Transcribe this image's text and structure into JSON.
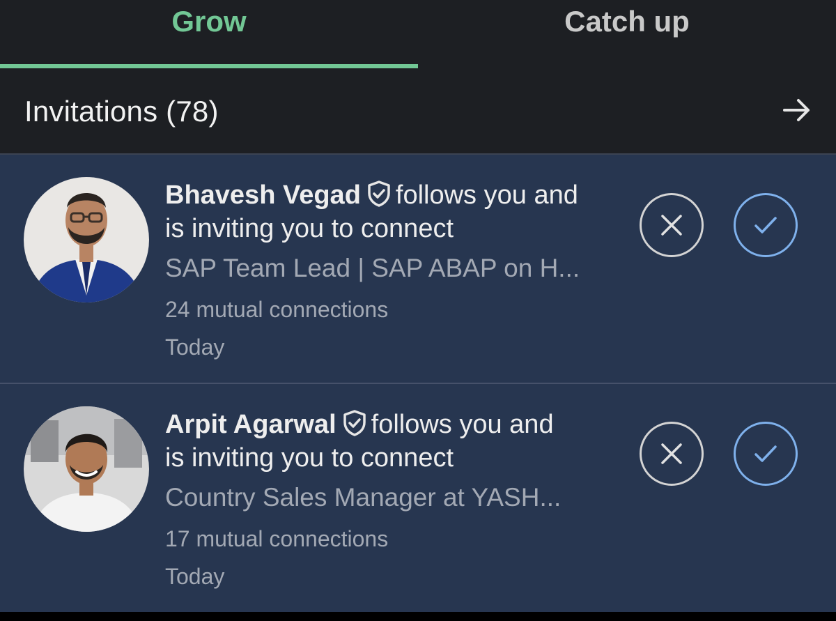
{
  "tabs": [
    {
      "label": "Grow",
      "active": true
    },
    {
      "label": "Catch up",
      "active": false
    }
  ],
  "colors": {
    "accent": "#72c795",
    "card_bg": "#273650",
    "header_bg": "#1d1f23",
    "accept_blue": "#7fb1ec"
  },
  "invitations": {
    "title": "Invitations (78)",
    "arrow_icon": "arrow-right-icon",
    "items": [
      {
        "name": "Bhavesh Vegad",
        "verified_icon": "verified-shield-icon",
        "action_text": "follows you and",
        "action_text_2": "is inviting you to connect",
        "headline": "SAP Team Lead | SAP ABAP on H...",
        "mutual": "24 mutual connections",
        "time": "Today"
      },
      {
        "name": "Arpit Agarwal",
        "verified_icon": "verified-shield-icon",
        "action_text": "follows you and",
        "action_text_2": "is inviting you to connect",
        "headline": "Country Sales Manager at YASH...",
        "mutual": "17 mutual connections",
        "time": "Today"
      }
    ]
  }
}
